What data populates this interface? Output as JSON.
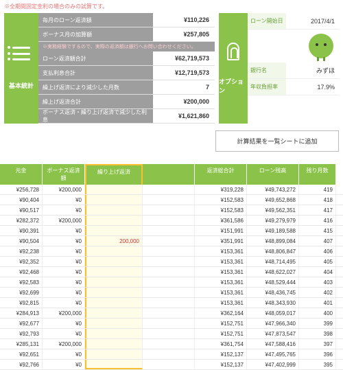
{
  "note": "※全期間固定金利の場合のみの試算です。",
  "stats_title": "基本統計",
  "stats": [
    {
      "label": "毎月のローン返済額",
      "value": "¥110,226"
    },
    {
      "label": "ボーナス月の加算額",
      "value": "¥257,805"
    }
  ],
  "subnote": "※実務経験でするので、実際の返済額は銀行へお問い合わせください。",
  "stats2": [
    {
      "label": "ローン返済額合計",
      "value": "¥62,719,573"
    },
    {
      "label": "支払利息合計",
      "value": "¥12,719,573"
    },
    {
      "label": "繰上げ返済により減少した月数",
      "value": "7"
    },
    {
      "label": "繰上げ返済合計",
      "value": "¥200,000"
    },
    {
      "label": "ボーナス返済・繰り上げ返済で減少した利息",
      "value": "¥1,621,860"
    }
  ],
  "option_title": "オプション",
  "info": [
    {
      "label": "ローン開始日",
      "value": "2017/4/1"
    },
    {
      "label": "銀行名",
      "value": "みずほ"
    },
    {
      "label": "年収負担率",
      "value": "17.9%"
    }
  ],
  "button": "計算結果を一覧シートに追加",
  "headers": [
    "元金",
    "ボーナス返済額",
    "繰り上げ返済",
    "返済総合計",
    "ローン残高",
    "残り月数"
  ],
  "rows": [
    {
      "c1": "¥256,728",
      "c2": "¥200,000",
      "c3": "",
      "c5": "¥319,228",
      "c6": "¥49,743,272",
      "c7": "419"
    },
    {
      "c1": "¥90,404",
      "c2": "¥0",
      "c3": "",
      "c5": "¥152,583",
      "c6": "¥49,652,868",
      "c7": "418"
    },
    {
      "c1": "¥90,517",
      "c2": "¥0",
      "c3": "",
      "c5": "¥152,583",
      "c6": "¥49,562,351",
      "c7": "417"
    },
    {
      "c1": "¥282,372",
      "c2": "¥200,000",
      "c3": "",
      "c5": "¥361,586",
      "c6": "¥49,279,979",
      "c7": "416"
    },
    {
      "c1": "¥90,391",
      "c2": "¥0",
      "c3": "",
      "c5": "¥151,991",
      "c6": "¥49,189,588",
      "c7": "415"
    },
    {
      "c1": "¥90,504",
      "c2": "¥0",
      "c3": "200,000",
      "c5": "¥351,991",
      "c6": "¥48,899,084",
      "c7": "407"
    },
    {
      "c1": "¥92,238",
      "c2": "¥0",
      "c3": "",
      "c5": "¥153,361",
      "c6": "¥48,806,847",
      "c7": "406"
    },
    {
      "c1": "¥92,352",
      "c2": "¥0",
      "c3": "",
      "c5": "¥153,361",
      "c6": "¥48,714,495",
      "c7": "405"
    },
    {
      "c1": "¥92,468",
      "c2": "¥0",
      "c3": "",
      "c5": "¥153,361",
      "c6": "¥48,622,027",
      "c7": "404"
    },
    {
      "c1": "¥92,583",
      "c2": "¥0",
      "c3": "",
      "c5": "¥153,361",
      "c6": "¥48,529,444",
      "c7": "403"
    },
    {
      "c1": "¥92,699",
      "c2": "¥0",
      "c3": "",
      "c5": "¥153,361",
      "c6": "¥48,436,745",
      "c7": "402"
    },
    {
      "c1": "¥92,815",
      "c2": "¥0",
      "c3": "",
      "c5": "¥153,361",
      "c6": "¥48,343,930",
      "c7": "401"
    },
    {
      "c1": "¥284,913",
      "c2": "¥200,000",
      "c3": "",
      "c5": "¥362,164",
      "c6": "¥48,059,017",
      "c7": "400"
    },
    {
      "c1": "¥92,677",
      "c2": "¥0",
      "c3": "",
      "c5": "¥152,751",
      "c6": "¥47,966,340",
      "c7": "399"
    },
    {
      "c1": "¥92,793",
      "c2": "¥0",
      "c3": "",
      "c5": "¥152,751",
      "c6": "¥47,873,547",
      "c7": "398"
    },
    {
      "c1": "¥285,131",
      "c2": "¥200,000",
      "c3": "",
      "c5": "¥361,754",
      "c6": "¥47,588,416",
      "c7": "397"
    },
    {
      "c1": "¥92,651",
      "c2": "¥0",
      "c3": "",
      "c5": "¥152,137",
      "c6": "¥47,495,765",
      "c7": "396"
    },
    {
      "c1": "¥92,766",
      "c2": "¥0",
      "c3": "",
      "c5": "¥152,137",
      "c6": "¥47,402,999",
      "c7": "395"
    }
  ]
}
